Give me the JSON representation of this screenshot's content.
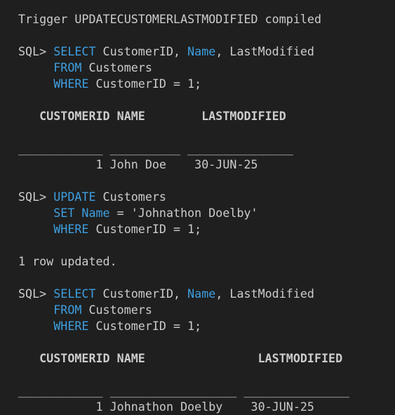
{
  "terminal": {
    "trigger_msg": "Trigger UPDATECUSTOMERLASTMODIFIED compiled",
    "prompt": "SQL> ",
    "indent": "     ",
    "query1": {
      "select_kw": "SELECT",
      "select_rest_a": " CustomerID, ",
      "name_col": "Name",
      "select_rest_b": ", LastModified",
      "from_kw": "FROM",
      "from_rest": " Customers",
      "where_kw": "WHERE",
      "where_rest": " CustomerID = 1;"
    },
    "result1": {
      "header": "   CUSTOMERID NAME        LASTMODIFIED",
      "divider": "____________ __________ _______________",
      "row": "           1 John Doe    30-JUN-25"
    },
    "update": {
      "update_kw": "UPDATE",
      "update_rest": " Customers",
      "set_kw": "SET",
      "set_space": " ",
      "name_col": "Name",
      "set_rest": " = 'Johnathon Doelby'",
      "where_kw": "WHERE",
      "where_rest": " CustomerID = 1;"
    },
    "update_msg": "1 row updated.",
    "query2": {
      "select_kw": "SELECT",
      "select_rest_a": " CustomerID, ",
      "name_col": "Name",
      "select_rest_b": ", LastModified",
      "from_kw": "FROM",
      "from_rest": " Customers",
      "where_kw": "WHERE",
      "where_rest": " CustomerID = 1;"
    },
    "result2": {
      "header": "   CUSTOMERID NAME                LASTMODIFIED",
      "divider": "____________ __________________ _______________",
      "row": "           1 Johnathon Doelby    30-JUN-25"
    }
  },
  "colors": {
    "background": "#1f1f1f",
    "text": "#cccccc",
    "keyword": "#3d9fe0"
  }
}
